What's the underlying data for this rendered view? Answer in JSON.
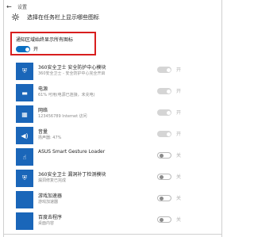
{
  "window": {
    "app_title": "设置",
    "back_icon": "back-arrow-icon"
  },
  "header": {
    "title": "选择在任务栏上显示哪些图标",
    "icon": "gear-icon"
  },
  "always_show": {
    "label": "通知区域始终显示所有图标",
    "state_label": "开",
    "on": true
  },
  "apps": [
    {
      "name": "360安全卫士 安全防护中心模块",
      "sub": "360安全卫士 - 安全防护中心完全开启",
      "icon": "shield-icon",
      "icon_glyph": "⛨",
      "toggle": "disabled",
      "state": "开"
    },
    {
      "name": "电源",
      "sub": "61% 可用(电源已连接，未充电)",
      "icon": "battery-icon",
      "icon_glyph": "▬",
      "toggle": "disabled",
      "state": "开"
    },
    {
      "name": "网络",
      "sub": "123456789 Internet 访问",
      "icon": "network-icon",
      "icon_glyph": "▦",
      "toggle": "disabled",
      "state": "开"
    },
    {
      "name": "音量",
      "sub": "扬声器: 47%",
      "icon": "volume-icon",
      "icon_glyph": "◀)",
      "toggle": "disabled",
      "state": "开"
    },
    {
      "name": "ASUS Smart Gesture Loader",
      "sub": "",
      "icon": "asus-gesture-icon",
      "icon_glyph": "☝",
      "toggle": "off",
      "state": "关"
    },
    {
      "name": "360安全卫士 漏洞补丁检测模块",
      "sub": "漏洞修复已完成",
      "icon": "shield-icon",
      "icon_glyph": "⛨",
      "toggle": "off",
      "state": "关"
    },
    {
      "name": "游戏加速器",
      "sub": "游戏加速器",
      "icon": "app-icon",
      "icon_glyph": "",
      "toggle": "off",
      "state": "关"
    },
    {
      "name": "百度去程序",
      "sub": "桌面内容",
      "icon": "app-icon",
      "icon_glyph": "",
      "toggle": "off",
      "state": "关"
    }
  ],
  "colors": {
    "accent": "#0a6fc2",
    "highlight_border": "#d81e1e",
    "app_icon_bg": "#1a66b9"
  }
}
